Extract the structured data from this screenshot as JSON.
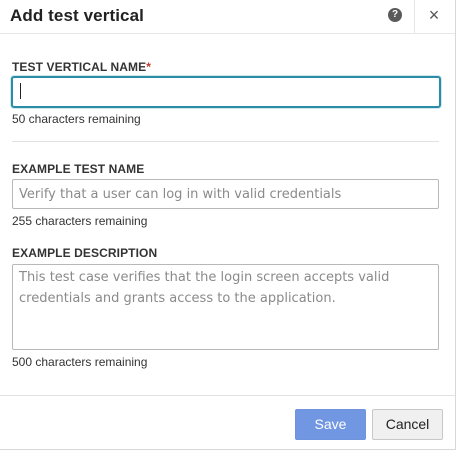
{
  "dialog": {
    "title": "Add test vertical",
    "help_icon_glyph": "?",
    "close_icon_glyph": "×"
  },
  "fields": {
    "vertical_name": {
      "label": "TEST VERTICAL NAME",
      "required_marker": "*",
      "value": "",
      "helper": "50 characters remaining"
    },
    "example_test_name": {
      "label": "EXAMPLE TEST NAME",
      "placeholder": "Verify that a user can log in with valid credentials",
      "helper": "255 characters remaining"
    },
    "example_description": {
      "label": "EXAMPLE DESCRIPTION",
      "placeholder": "This test case verifies that the login screen accepts valid credentials and grants access to the application.",
      "helper": "500 characters remaining"
    }
  },
  "footer": {
    "save_label": "Save",
    "cancel_label": "Cancel"
  },
  "colors": {
    "focus_border": "#2a8ca6",
    "primary_button": "#7196e2",
    "required_marker": "#c0392b"
  }
}
